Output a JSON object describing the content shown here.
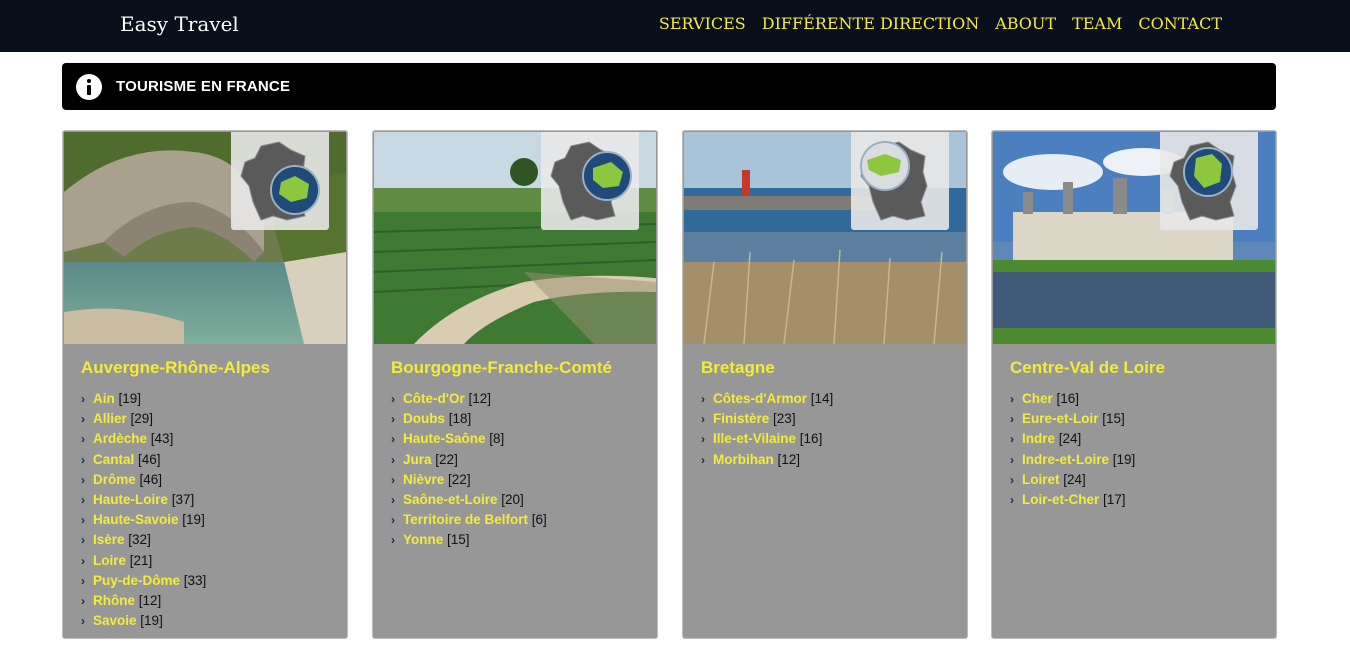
{
  "header": {
    "brand": "Easy Travel",
    "nav": [
      "SERVICES",
      "DIFFÉRENTE DIRECTION",
      "ABOUT",
      "TEAM",
      "CONTACT"
    ]
  },
  "info_bar": {
    "icon": "info-icon",
    "title": "TOURISME EN FRANCE"
  },
  "colors": {
    "topbar": "#0a0f1c",
    "accent": "#f4ec3c",
    "card_bg": "#979797",
    "map_highlight": "#8dc63f"
  },
  "cards": [
    {
      "region": "Auvergne-Rhône-Alpes",
      "departments": [
        {
          "name": "Ain",
          "count": "[19]"
        },
        {
          "name": "Allier",
          "count": "[29]"
        },
        {
          "name": "Ardèche",
          "count": "[43]"
        },
        {
          "name": "Cantal",
          "count": "[46]"
        },
        {
          "name": "Drôme",
          "count": "[46]"
        },
        {
          "name": "Haute-Loire",
          "count": "[37]"
        },
        {
          "name": "Haute-Savoie",
          "count": "[19]"
        },
        {
          "name": "Isère",
          "count": "[32]"
        },
        {
          "name": "Loire",
          "count": "[21]"
        },
        {
          "name": "Puy-de-Dôme",
          "count": "[33]"
        },
        {
          "name": "Rhône",
          "count": "[12]"
        },
        {
          "name": "Savoie",
          "count": "[19]"
        }
      ]
    },
    {
      "region": "Bourgogne-Franche-Comté",
      "departments": [
        {
          "name": "Côte-d'Or",
          "count": "[12]"
        },
        {
          "name": "Doubs",
          "count": "[18]"
        },
        {
          "name": "Haute-Saône",
          "count": "[8]"
        },
        {
          "name": "Jura",
          "count": "[22]"
        },
        {
          "name": "Nièvre",
          "count": "[22]"
        },
        {
          "name": "Saône-et-Loire",
          "count": "[20]"
        },
        {
          "name": "Territoire de Belfort",
          "count": "[6]"
        },
        {
          "name": "Yonne",
          "count": "[15]"
        }
      ]
    },
    {
      "region": "Bretagne",
      "departments": [
        {
          "name": "Côtes-d'Armor",
          "count": "[14]"
        },
        {
          "name": "Finistère",
          "count": "[23]"
        },
        {
          "name": "Ille-et-Vilaine",
          "count": "[16]"
        },
        {
          "name": "Morbihan",
          "count": "[12]"
        }
      ]
    },
    {
      "region": "Centre-Val de Loire",
      "departments": [
        {
          "name": "Cher",
          "count": "[16]"
        },
        {
          "name": "Eure-et-Loir",
          "count": "[15]"
        },
        {
          "name": "Indre",
          "count": "[24]"
        },
        {
          "name": "Indre-et-Loire",
          "count": "[19]"
        },
        {
          "name": "Loiret",
          "count": "[24]"
        },
        {
          "name": "Loir-et-Cher",
          "count": "[17]"
        }
      ]
    }
  ]
}
